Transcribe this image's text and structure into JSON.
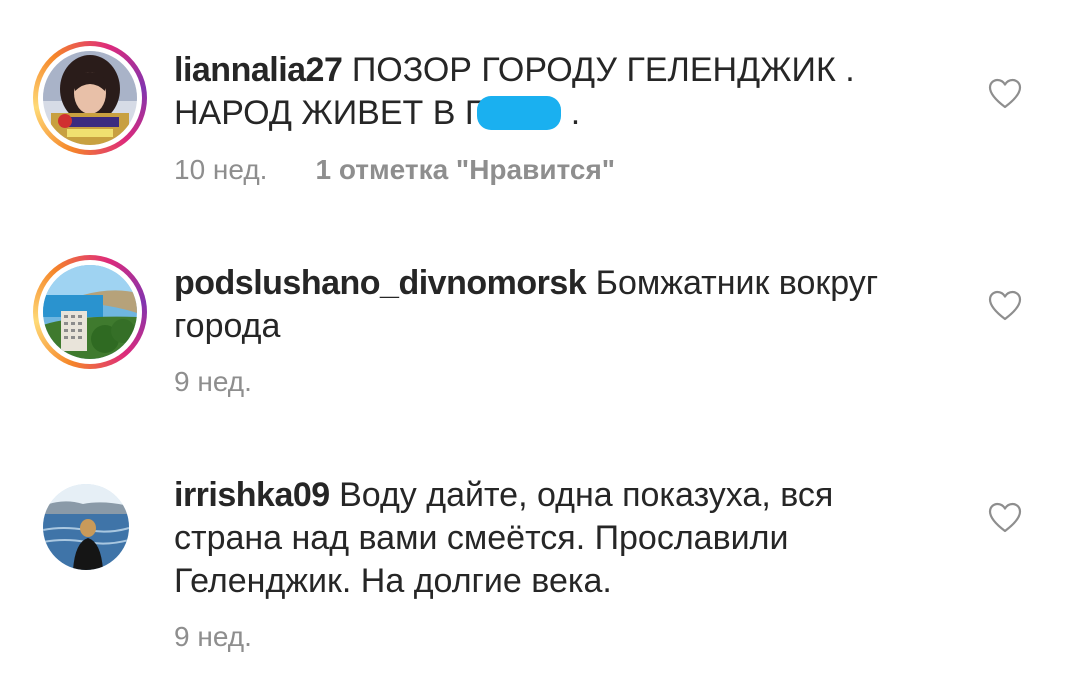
{
  "comments": [
    {
      "username": "liannalia27",
      "text_part1": " ПОЗОР ГОРОДУ ГЕЛЕНДЖИК . НАРОД ЖИВЕТ В Г",
      "text_part2": " .",
      "age": "10 нед.",
      "likes": "1 отметка \"Нравится\"",
      "avatar_icon": "woman-portrait-avatar",
      "story_ring": true
    },
    {
      "username": "podslushano_divnomorsk",
      "text": " Бомжатник вокруг города",
      "age": "9 нед.",
      "avatar_icon": "seaside-hotel-avatar",
      "story_ring": true
    },
    {
      "username": "irrishka09",
      "text": " Воду дайте, одна показуха, вся страна над вами смеётся. Прославили Геленджик. На долгие века.",
      "age": "9 нед.",
      "avatar_icon": "sea-person-avatar",
      "story_ring": false
    }
  ],
  "colors": {
    "text": "#262626",
    "meta": "#8e8e8e",
    "censor_blob": "#1ab0f0",
    "heart_outline": "#8e8e8e"
  }
}
